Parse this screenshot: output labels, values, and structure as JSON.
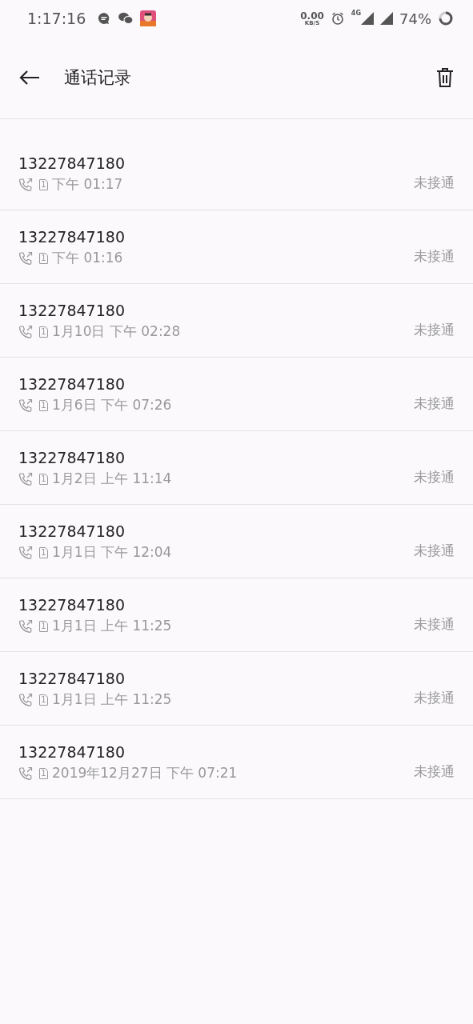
{
  "status_bar": {
    "time": "1:17:16",
    "net_speed": "0.00",
    "net_unit": "KB/S",
    "network": "4G",
    "battery": "74%"
  },
  "header": {
    "title": "通话记录"
  },
  "calls": [
    {
      "number": "13227847180",
      "sim": "1",
      "time": "下午 01:17",
      "status": "未接通"
    },
    {
      "number": "13227847180",
      "sim": "1",
      "time": "下午 01:16",
      "status": "未接通"
    },
    {
      "number": "13227847180",
      "sim": "1",
      "time": "1月10日 下午 02:28",
      "status": "未接通"
    },
    {
      "number": "13227847180",
      "sim": "1",
      "time": "1月6日 下午 07:26",
      "status": "未接通"
    },
    {
      "number": "13227847180",
      "sim": "1",
      "time": "1月2日 上午 11:14",
      "status": "未接通"
    },
    {
      "number": "13227847180",
      "sim": "1",
      "time": "1月1日 下午 12:04",
      "status": "未接通"
    },
    {
      "number": "13227847180",
      "sim": "1",
      "time": "1月1日 上午 11:25",
      "status": "未接通"
    },
    {
      "number": "13227847180",
      "sim": "1",
      "time": "1月1日 上午 11:25",
      "status": "未接通"
    },
    {
      "number": "13227847180",
      "sim": "1",
      "time": "2019年12月27日 下午 07:21",
      "status": "未接通"
    }
  ]
}
